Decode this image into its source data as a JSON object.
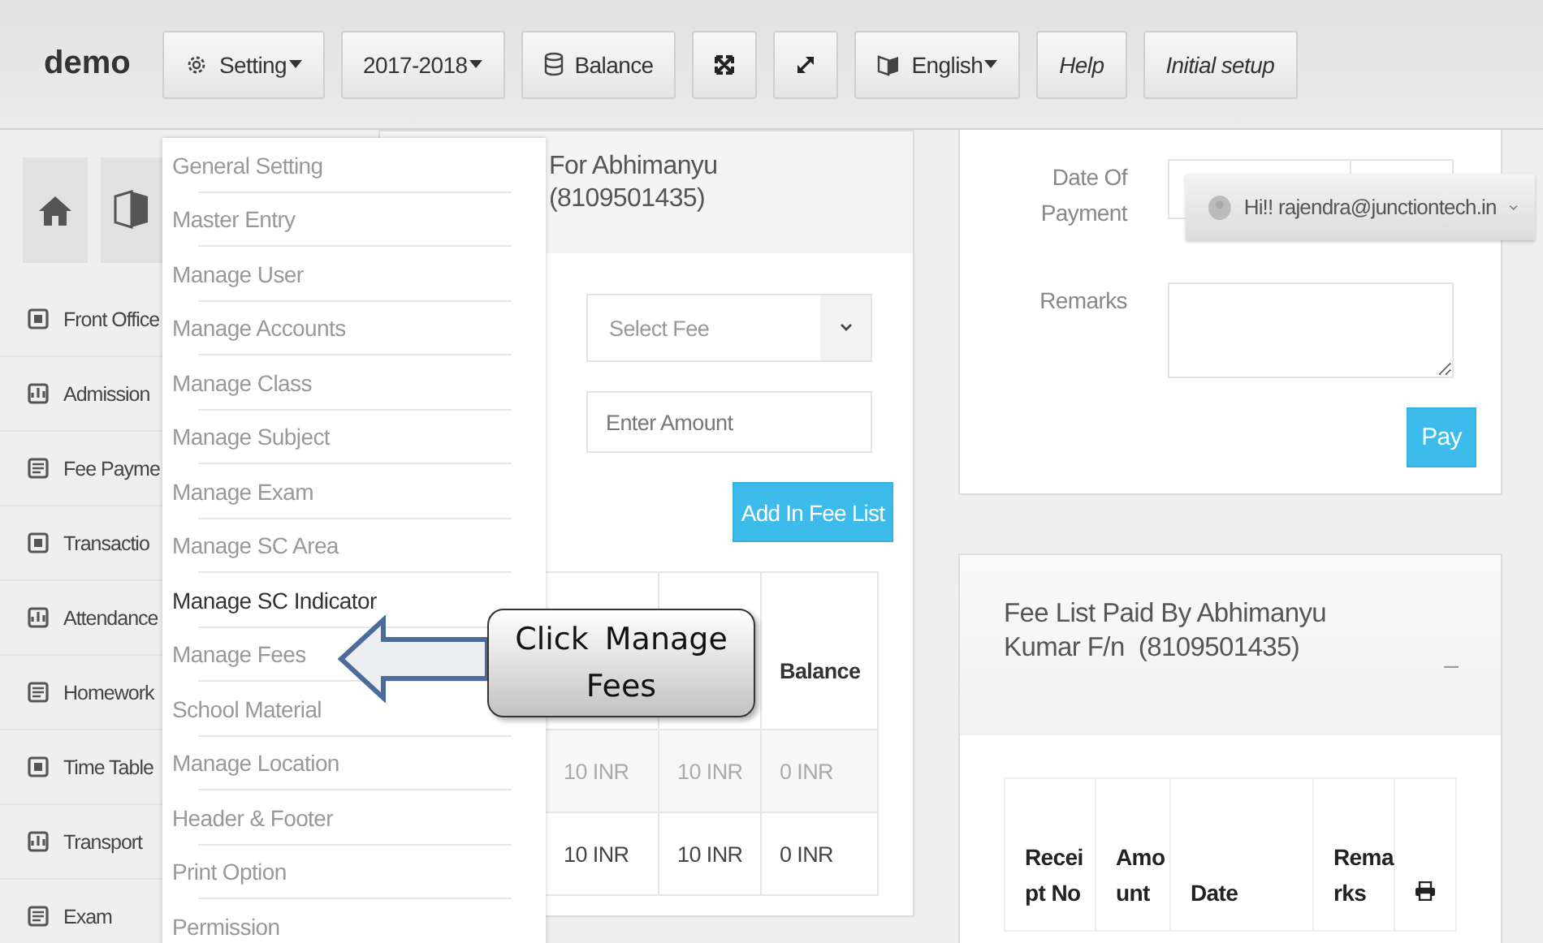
{
  "header": {
    "brand": "demo",
    "buttons": [
      {
        "label": "Setting",
        "kind": "dropdown"
      },
      {
        "label": "2017-2018",
        "kind": "dropdown"
      },
      {
        "label": "Balance",
        "kind": "plain"
      },
      {
        "kind": "icon"
      },
      {
        "kind": "icon"
      },
      {
        "label": "English",
        "kind": "dropdown"
      },
      {
        "label": "Help",
        "kind": "italic"
      },
      {
        "label": "Initial setup",
        "kind": "italic"
      }
    ]
  },
  "sidebar": {
    "items": [
      "Front Office",
      "Admission",
      "Fee Payme",
      "Transactio",
      "Attendance",
      "Homework",
      "Time Table",
      "Transport",
      "Exam"
    ]
  },
  "fee_form": {
    "title": "For Abhimanyu (8109501435)",
    "select": {
      "placeholder": "Select Fee"
    },
    "amount": {
      "placeholder": "Enter Amount"
    },
    "add_button": "Add In Fee List",
    "table": {
      "column_3": {
        "heading": "Balance"
      },
      "rows": [
        {
          "cells": [
            "10 INR",
            "10 INR",
            "0 INR"
          ],
          "striped": true
        },
        {
          "cells": [
            "10 INR",
            "10 INR",
            "0 INR"
          ],
          "striped": false
        }
      ]
    }
  },
  "payment": {
    "date_label": "Date Of Payment",
    "remarks_label": "Remarks",
    "pay_button": "Pay"
  },
  "fee_list": {
    "title": "Fee List Paid By Abhimanyu Kumar F/n  (8109501435)",
    "collapse": "–",
    "columns": [
      "Receipt No",
      "Amount",
      "Date",
      "Remarks"
    ]
  },
  "user_menu": {
    "greeting": "Hi!! rajendra@junctiontech.in"
  },
  "settings_menu": {
    "items": [
      {
        "label": "General Setting",
        "selected": false
      },
      {
        "label": "Master Entry",
        "selected": false
      },
      {
        "label": "Manage User",
        "selected": false
      },
      {
        "label": "Manage Accounts",
        "selected": false
      },
      {
        "label": "Manage Class",
        "selected": false
      },
      {
        "label": "Manage Subject",
        "selected": false
      },
      {
        "label": "Manage Exam",
        "selected": false
      },
      {
        "label": "Manage SC Area",
        "selected": false
      },
      {
        "label": "Manage SC Indicator",
        "selected": true
      },
      {
        "label": "Manage Fees",
        "selected": false
      },
      {
        "label": "School Material",
        "selected": false
      },
      {
        "label": "Manage Location",
        "selected": false
      },
      {
        "label": "Header & Footer",
        "selected": false
      },
      {
        "label": "Print Option",
        "selected": false
      },
      {
        "label": "Permission",
        "selected": false
      }
    ]
  },
  "callout": {
    "text": "Click Manage Fees"
  }
}
